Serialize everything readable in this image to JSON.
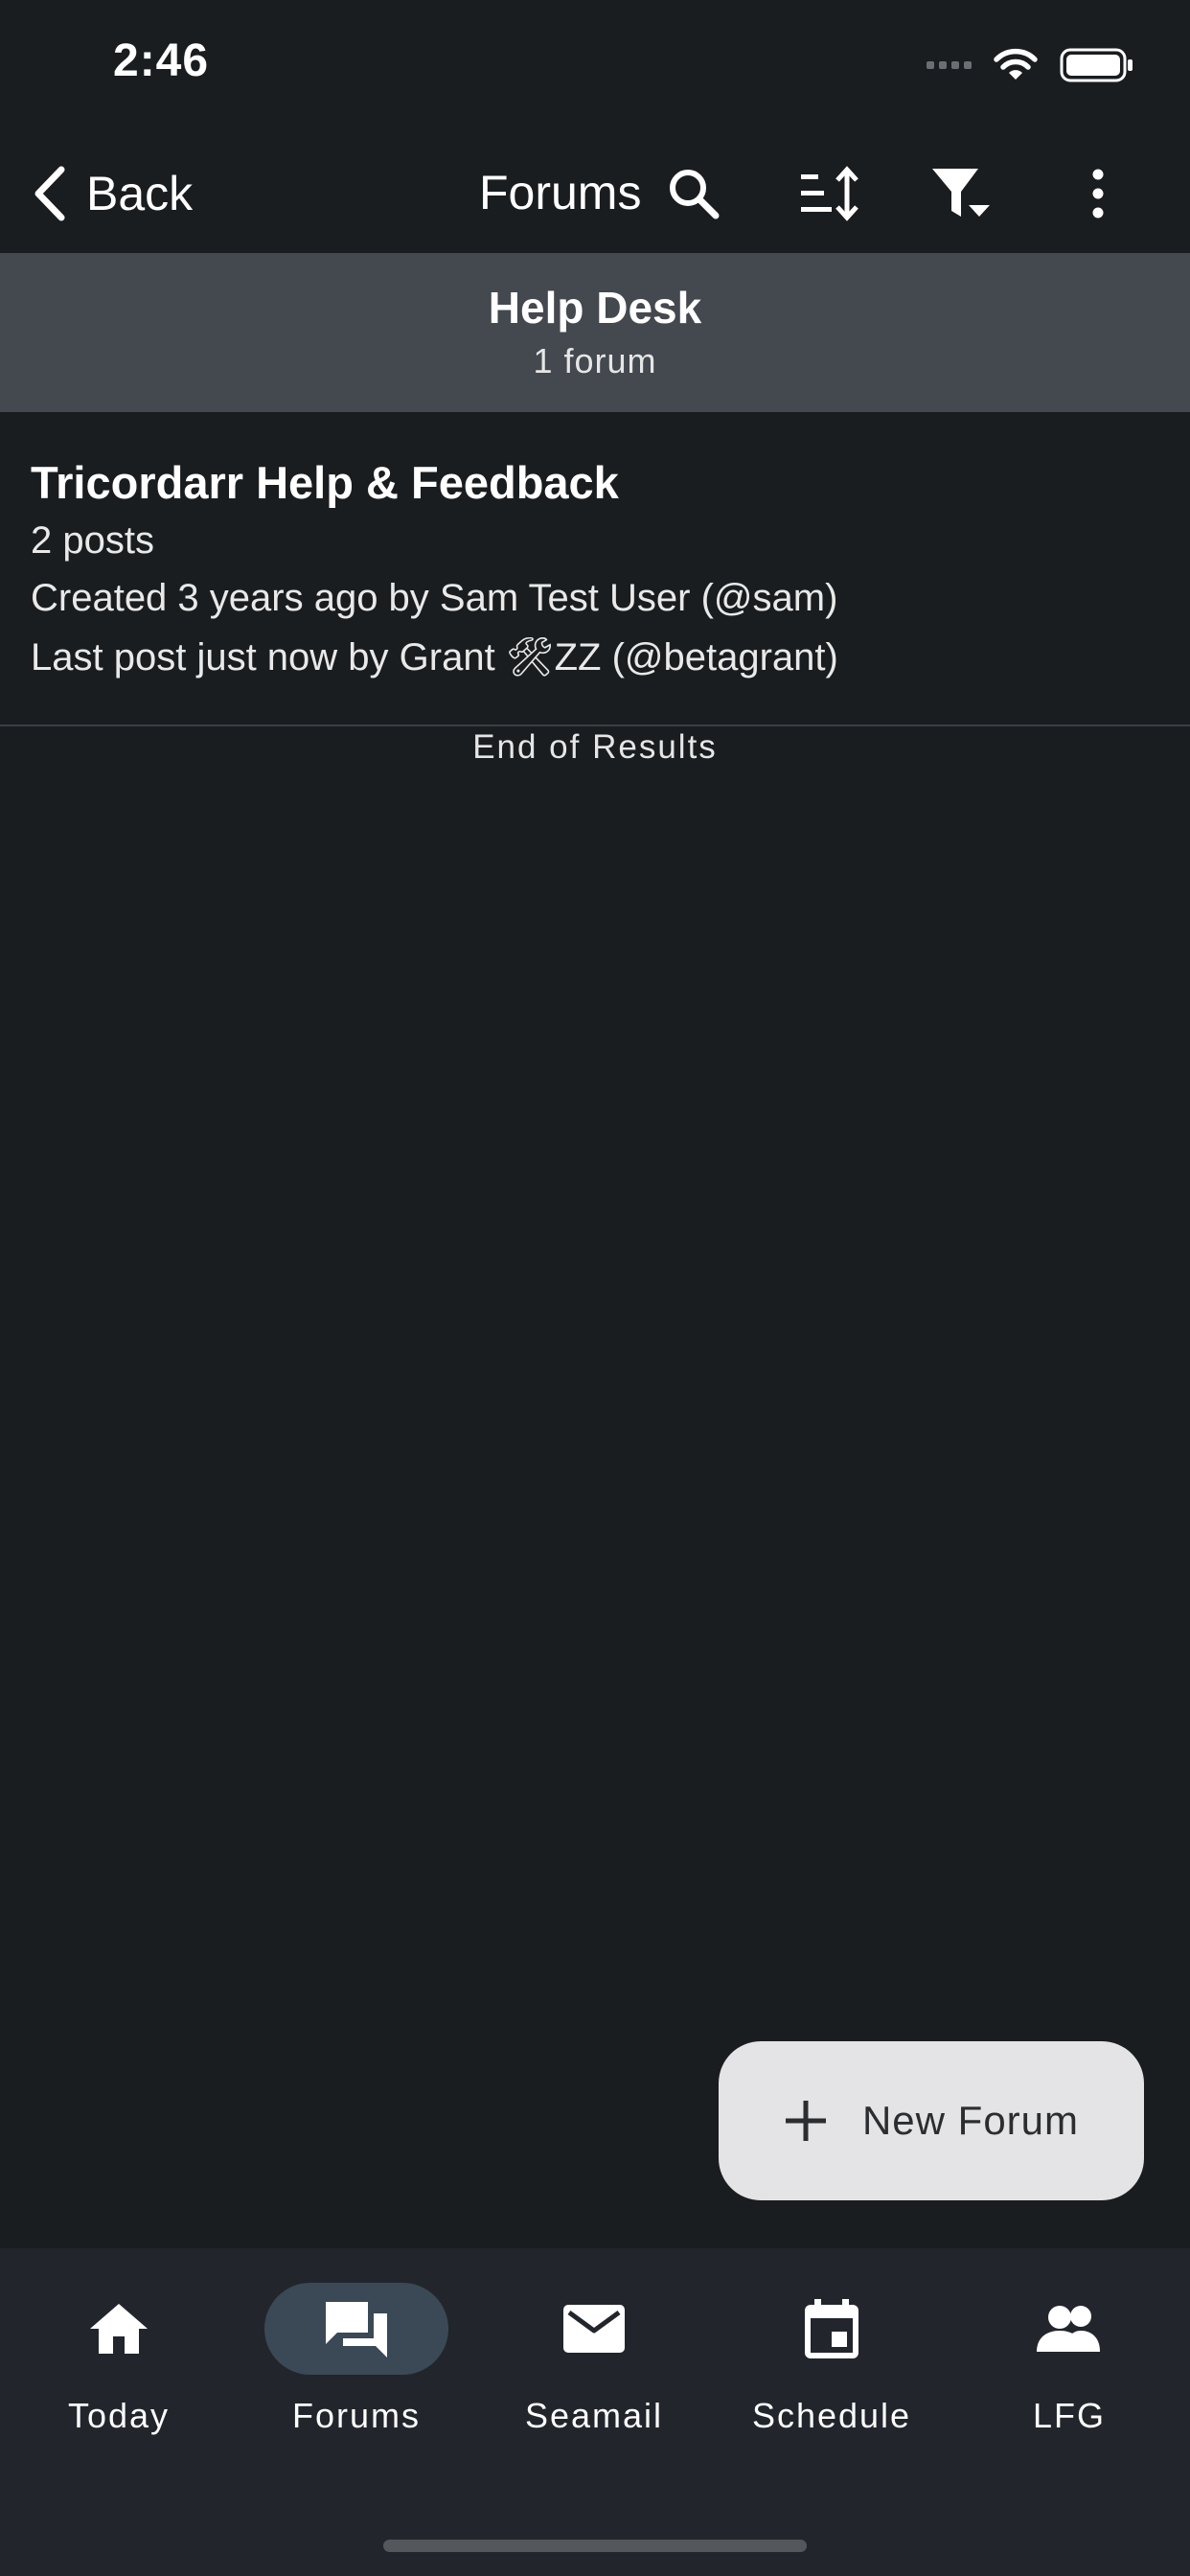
{
  "status_bar": {
    "time": "2:46"
  },
  "app_bar": {
    "back_label": "Back",
    "title": "Forums",
    "icons": [
      "search-icon",
      "sort-icon",
      "filter-icon",
      "more-vertical-icon"
    ]
  },
  "section": {
    "title": "Help Desk",
    "subtitle": "1 forum"
  },
  "forums": [
    {
      "title": "Tricordarr Help & Feedback",
      "posts": "2 posts",
      "created": "Created 3 years ago by Sam Test User (@sam)",
      "last_post": "Last post just now by Grant 🛠ZZ (@betagrant)"
    }
  ],
  "end_of_results": "End of Results",
  "fab": {
    "label": "New Forum",
    "icon": "plus-icon"
  },
  "bottom_nav": [
    {
      "label": "Today",
      "icon": "home-icon",
      "active": false
    },
    {
      "label": "Forums",
      "icon": "forum-icon",
      "active": true
    },
    {
      "label": "Seamail",
      "icon": "mail-icon",
      "active": false
    },
    {
      "label": "Schedule",
      "icon": "calendar-icon",
      "active": false
    },
    {
      "label": "LFG",
      "icon": "people-icon",
      "active": false
    }
  ],
  "colors": {
    "background": "#1a1d20",
    "header_band": "#44484f",
    "nav_background": "#22262c",
    "nav_active_pill": "#3a4955",
    "fab_background": "#e4e3e6"
  }
}
